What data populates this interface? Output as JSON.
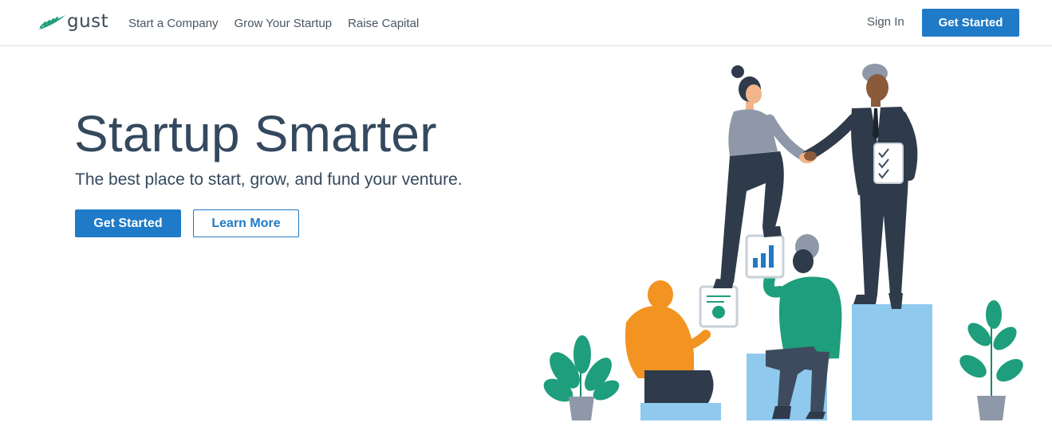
{
  "header": {
    "logo_text": "gust",
    "nav": [
      "Start a Company",
      "Grow Your Startup",
      "Raise Capital"
    ],
    "sign_in": "Sign In",
    "cta": "Get Started"
  },
  "hero": {
    "title": "Startup Smarter",
    "subtitle": "The best place to start, grow, and fund your venture.",
    "primary_cta": "Get Started",
    "secondary_cta": "Learn More"
  },
  "icons": {
    "logo": "gust-wing-logo",
    "illustration": "team-handshake-illustration"
  },
  "colors": {
    "brand_blue": "#1f7ac7",
    "heading": "#34495e",
    "nav_text": "#4a5663",
    "pedestal_blue": "#8fc9ee",
    "plant_green": "#1e9e7c",
    "accent_orange": "#f39322",
    "suit_navy": "#2f3b4b"
  }
}
